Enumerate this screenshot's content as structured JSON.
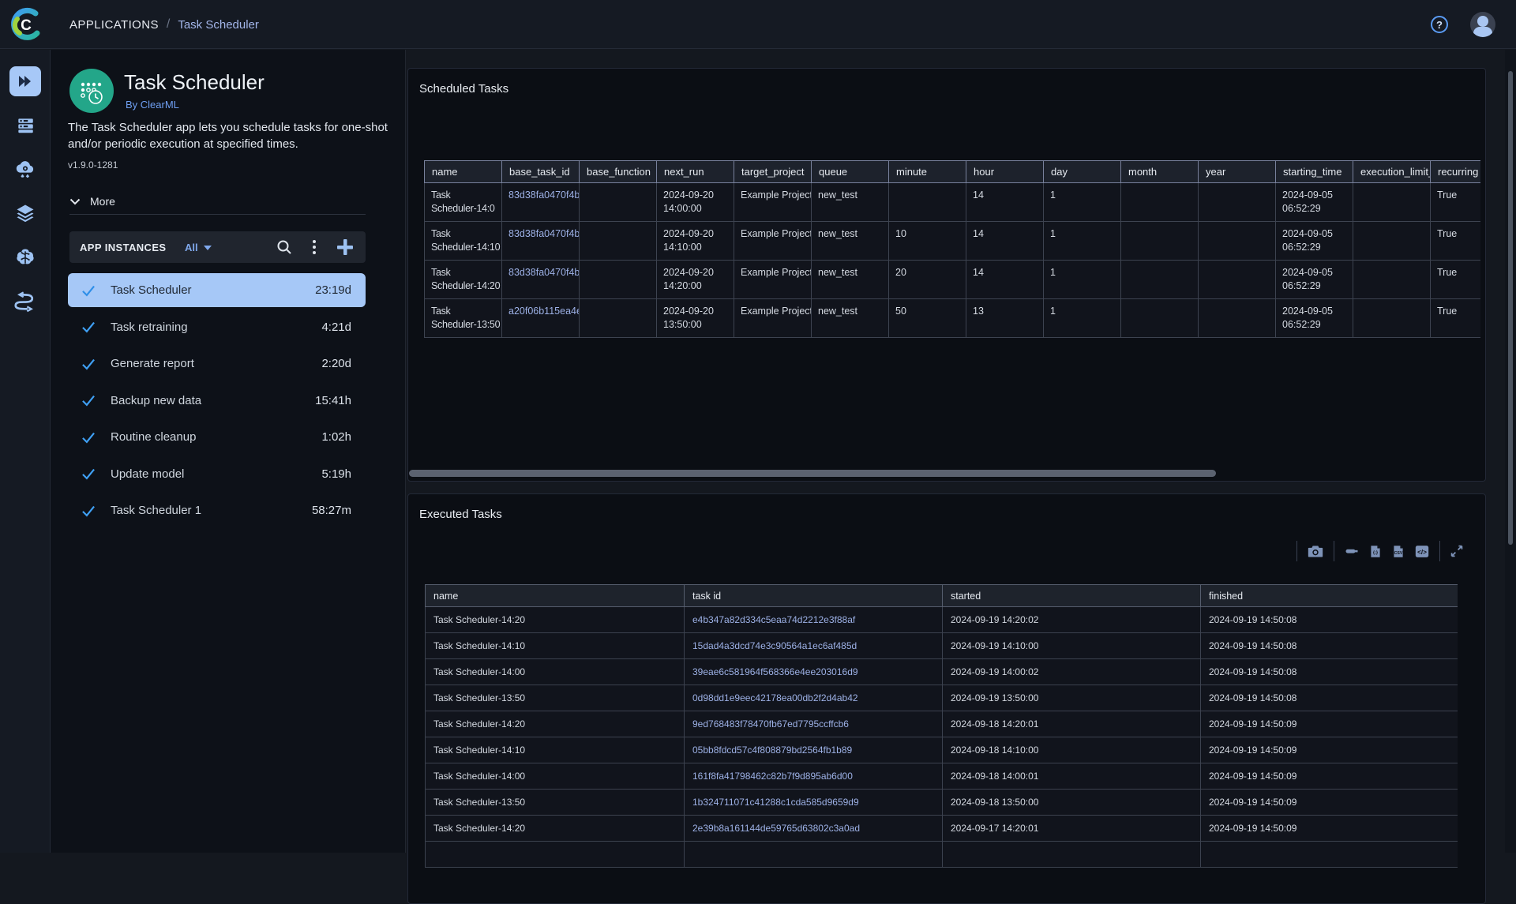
{
  "topbar": {
    "breadcrumb_root": "APPLICATIONS",
    "breadcrumb_sep": "/",
    "breadcrumb_current": "Task Scheduler",
    "help_label": "?"
  },
  "sidebar_icons": [
    "apps",
    "workers-queues",
    "cloud-autoscaler",
    "datasets",
    "models",
    "pipelines"
  ],
  "app_panel": {
    "title": "Task Scheduler",
    "byline": "By ClearML",
    "description_lines": [
      "The Task Scheduler app lets you schedule tasks for one-shot",
      "and/or periodic execution at specified times."
    ],
    "version": "v1.9.0-1281",
    "more_label": "More"
  },
  "instances": {
    "header": "APP INSTANCES",
    "filter": "All",
    "items": [
      {
        "name": "Task Scheduler",
        "time": "23:19d",
        "selected": true
      },
      {
        "name": "Task retraining",
        "time": "4:21d",
        "selected": false
      },
      {
        "name": "Generate report",
        "time": "2:20d",
        "selected": false
      },
      {
        "name": "Backup new data",
        "time": "15:41h",
        "selected": false
      },
      {
        "name": "Routine cleanup",
        "time": "1:02h",
        "selected": false
      },
      {
        "name": "Update model",
        "time": "5:19h",
        "selected": false
      },
      {
        "name": "Task Scheduler 1",
        "time": "58:27m",
        "selected": false
      }
    ]
  },
  "scheduled": {
    "title": "Scheduled Tasks",
    "columns": [
      "name",
      "base_task_id",
      "base_function",
      "next_run",
      "target_project",
      "queue",
      "minute",
      "hour",
      "day",
      "month",
      "year",
      "starting_time",
      "execution_limit_h",
      "recurring"
    ],
    "link_col": 1,
    "rows": [
      [
        "Task Scheduler-14:0",
        "83d38fa0470f4b",
        "",
        "2024-09-20 14:00:00",
        "Example Project",
        "new_test",
        "",
        "14",
        "1",
        "",
        "",
        "2024-09-05 06:52:29",
        "",
        "True"
      ],
      [
        "Task Scheduler-14:10",
        "83d38fa0470f4b",
        "",
        "2024-09-20 14:10:00",
        "Example Project",
        "new_test",
        "10",
        "14",
        "1",
        "",
        "",
        "2024-09-05 06:52:29",
        "",
        "True"
      ],
      [
        "Task Scheduler-14:20",
        "83d38fa0470f4b",
        "",
        "2024-09-20 14:20:00",
        "Example Project",
        "new_test",
        "20",
        "14",
        "1",
        "",
        "",
        "2024-09-05 06:52:29",
        "",
        "True"
      ],
      [
        "Task Scheduler-13:50",
        "a20f06b115ea4e",
        "",
        "2024-09-20 13:50:00",
        "Example Project",
        "new_test",
        "50",
        "13",
        "1",
        "",
        "",
        "2024-09-05 06:52:29",
        "",
        "True"
      ]
    ]
  },
  "executed": {
    "title": "Executed Tasks",
    "columns": [
      "name",
      "task id",
      "started",
      "finished"
    ],
    "link_col": 1,
    "toolbar_icons": [
      "camera-icon",
      "pan-icon",
      "json-file-icon",
      "csv-file-icon",
      "code-file-icon",
      "expand-icon"
    ],
    "rows": [
      [
        "Task Scheduler-14:20",
        "e4b347a82d334c5eaa74d2212e3f88af",
        "2024-09-19 14:20:02",
        "2024-09-19 14:50:08"
      ],
      [
        "Task Scheduler-14:10",
        "15dad4a3dcd74e3c90564a1ec6af485d",
        "2024-09-19 14:10:00",
        "2024-09-19 14:50:08"
      ],
      [
        "Task Scheduler-14:00",
        "39eae6c581964f568366e4ee203016d9",
        "2024-09-19 14:00:02",
        "2024-09-19 14:50:08"
      ],
      [
        "Task Scheduler-13:50",
        "0d98dd1e9eec42178ea00db2f2d4ab42",
        "2024-09-19 13:50:00",
        "2024-09-19 14:50:08"
      ],
      [
        "Task Scheduler-14:20",
        "9ed768483f78470fb67ed7795ccffcb6",
        "2024-09-18 14:20:01",
        "2024-09-19 14:50:09"
      ],
      [
        "Task Scheduler-14:10",
        "05bb8fdcd57c4f808879bd2564fb1b89",
        "2024-09-18 14:10:00",
        "2024-09-19 14:50:09"
      ],
      [
        "Task Scheduler-14:00",
        "161f8fa41798462c82b7f9d895ab6d00",
        "2024-09-18 14:00:01",
        "2024-09-19 14:50:09"
      ],
      [
        "Task Scheduler-13:50",
        "1b324711071c41288c1cda585d9659d9",
        "2024-09-18 13:50:00",
        "2024-09-19 14:50:09"
      ],
      [
        "Task Scheduler-14:20",
        "2e39b8a161144de59765d63802c3a0ad",
        "2024-09-17 14:20:01",
        "2024-09-19 14:50:09"
      ],
      [
        "",
        "",
        "",
        ""
      ]
    ]
  },
  "colors": {
    "accent_selected": "#a6c8f7",
    "link": "#9db1e6",
    "app_icon_green": "#23a689",
    "check_blue": "#3fa0f4"
  }
}
